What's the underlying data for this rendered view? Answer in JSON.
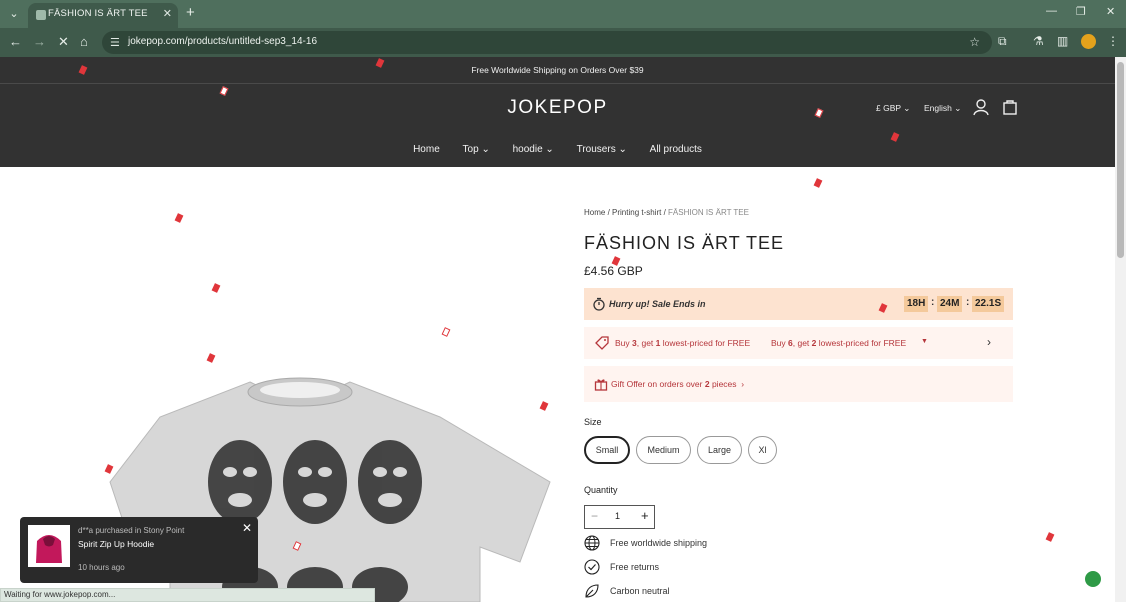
{
  "browser": {
    "tab_title": "FĀSHION IS ÄRT TEE",
    "url": "jokepop.com/products/untitled-sep3_14-16",
    "status": "Waiting for www.jokepop.com..."
  },
  "announcement": "Free Worldwide Shipping on Orders Over $39",
  "header": {
    "logo": "JOKEPOP",
    "currency": "£ GBP",
    "language": "English",
    "nav": [
      "Home",
      "Top",
      "hoodie",
      "Trousers",
      "All products"
    ]
  },
  "breadcrumb": {
    "home": "Home",
    "category": "Printing t-shirt",
    "current": "FĀSHION IS ÄRT TEE"
  },
  "product": {
    "title": "FÄSHION IS ÄRT TEE",
    "price": "£4.56 GBP"
  },
  "sale": {
    "text": "Hurry up! Sale Ends in",
    "hours": "18H",
    "minutes": "24M",
    "seconds": "22.1S"
  },
  "promo": {
    "offer1_pre": "Buy ",
    "offer1_qty": "3",
    "offer1_mid": ", get ",
    "offer1_free": "1",
    "offer1_post": " lowest-priced for FREE",
    "offer2_pre": "Buy ",
    "offer2_qty": "6",
    "offer2_mid": ", get ",
    "offer2_free": "2",
    "offer2_post": " lowest-priced for FREE"
  },
  "gift": {
    "text_pre": "Gift Offer on orders over ",
    "count": "2",
    "text_post": " pieces"
  },
  "size": {
    "label": "Size",
    "options": [
      "Small",
      "Medium",
      "Large",
      "Xl"
    ]
  },
  "quantity": {
    "label": "Quantity",
    "value": "1"
  },
  "features": [
    "Free worldwide shipping",
    "Free returns",
    "Carbon neutral"
  ],
  "popup": {
    "who": "d**a purchased in Stony Point",
    "product": "Spirit Zip Up Hoodie",
    "time": "10 hours ago"
  }
}
